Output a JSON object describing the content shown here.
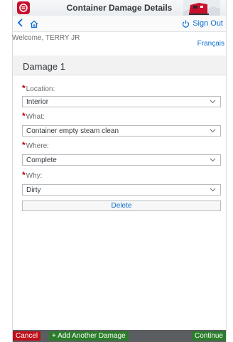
{
  "header": {
    "title": "Container Damage Details"
  },
  "nav": {
    "back_icon": "chevron-left-icon",
    "home_icon": "home-icon",
    "signout_label": "Sign Out"
  },
  "welcome": "Welcome, TERRY JR",
  "language_link": "Français",
  "section": {
    "title": "Damage 1"
  },
  "fields": [
    {
      "label": "Location:",
      "value": "Interior"
    },
    {
      "label": "What:",
      "value": "Container empty steam clean"
    },
    {
      "label": "Where:",
      "value": "Complete"
    },
    {
      "label": "Why:",
      "value": "Dirty"
    }
  ],
  "delete_label": "Delete",
  "footer": {
    "cancel_label": "Cancel",
    "add_label": "+ Add Another Damage",
    "continue_label": "Continue"
  },
  "colors": {
    "accent": "#0a6ed1",
    "brand_red": "#c8102e",
    "cancel": "#c0101a",
    "success": "#2b7d2b"
  }
}
